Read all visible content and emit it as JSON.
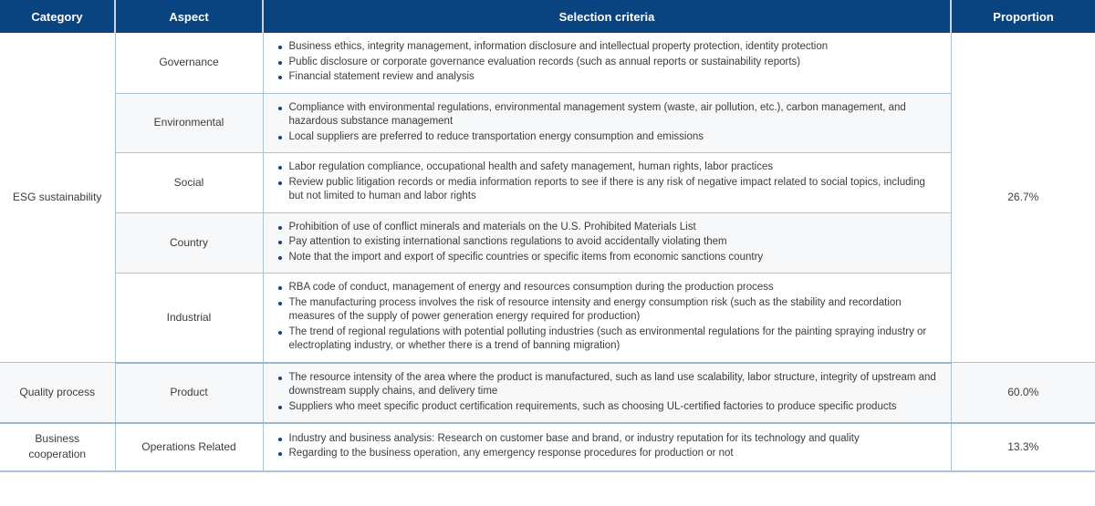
{
  "table": {
    "headers": [
      {
        "label": "Category",
        "name": "header-category"
      },
      {
        "label": "Aspect",
        "name": "header-aspect"
      },
      {
        "label": "Selection criteria",
        "name": "header-selection-criteria"
      },
      {
        "label": "Proportion",
        "name": "header-proportion"
      }
    ],
    "colors": {
      "header_background": "#0a4480",
      "header_text": "#ffffff",
      "border": "#adc2da",
      "group_border": "#9fb6d2",
      "row_tint": "#f7f8f9",
      "bullet": "#1b3f78",
      "body_text": "#3c3c3c"
    },
    "groups": [
      {
        "category": "ESG sustainability",
        "proportion": "26.7%",
        "rows": [
          {
            "aspect": "Governance",
            "tint": false,
            "criteria": [
              "Business ethics, integrity management, information disclosure and intellectual property protection, identity protection",
              "Public disclosure or corporate governance evaluation records (such as annual reports or sustainability reports)",
              "Financial statement review and analysis"
            ]
          },
          {
            "aspect": "Environmental",
            "tint": true,
            "criteria": [
              "Compliance with environmental regulations, environmental management system (waste, air pollution, etc.), carbon management, and hazardous substance management",
              "Local suppliers are preferred to reduce transportation energy consumption and emissions"
            ]
          },
          {
            "aspect": "Social",
            "tint": false,
            "criteria": [
              "Labor regulation compliance, occupational health and safety management, human rights, labor practices",
              "Review public litigation records or media information reports to see if there is any risk of negative impact related to social topics, including but not limited to human and labor rights"
            ]
          },
          {
            "aspect": "Country",
            "tint": true,
            "criteria": [
              "Prohibition of use of conflict minerals and materials on the U.S. Prohibited Materials List",
              "Pay attention to existing international sanctions regulations to avoid accidentally violating them",
              "Note that the import and export of specific countries or specific items from economic sanctions country"
            ]
          },
          {
            "aspect": "Industrial",
            "tint": false,
            "criteria": [
              "RBA code of conduct, management of energy and resources consumption during the production process",
              "The manufacturing process involves the risk of resource intensity and energy consumption risk (such as the stability and recordation measures of the supply of power generation energy required for production)",
              "The trend of regional regulations with potential polluting industries (such as environmental regulations for the painting spraying industry or electroplating industry, or whether there is a trend of banning migration)"
            ]
          }
        ]
      },
      {
        "category": "Quality process",
        "proportion": "60.0%",
        "rows": [
          {
            "aspect": "Product",
            "tint": true,
            "criteria": [
              "The resource intensity of the area where the product is manufactured, such as land use scalability, labor structure, integrity of upstream and downstream supply chains, and delivery time",
              "Suppliers who meet specific product certification requirements, such as choosing UL-certified factories to produce specific products"
            ]
          }
        ]
      },
      {
        "category": "Business cooperation",
        "proportion": "13.3%",
        "rows": [
          {
            "aspect": "Operations Related",
            "tint": false,
            "criteria": [
              "Industry and business analysis: Research on customer base and brand, or industry reputation for its technology and quality",
              "Regarding to the business operation, any emergency response procedures for production or not"
            ]
          }
        ]
      }
    ]
  }
}
